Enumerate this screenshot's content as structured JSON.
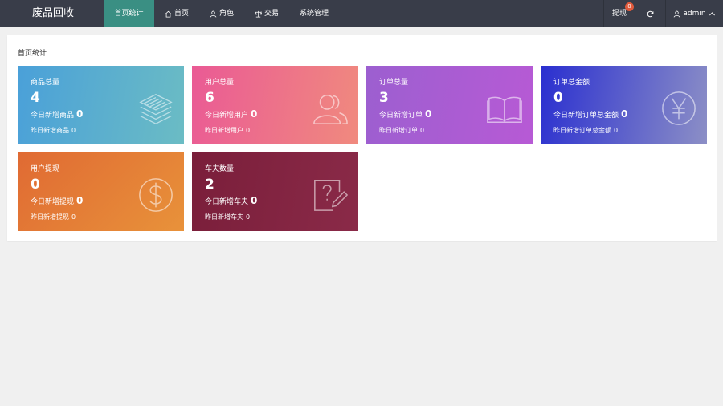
{
  "app": {
    "brand": "废品回收"
  },
  "nav": [
    {
      "label": "首页统计",
      "icon": "",
      "active": true
    },
    {
      "label": "首页",
      "icon": "home-icon"
    },
    {
      "label": "角色",
      "icon": "user-icon"
    },
    {
      "label": "交易",
      "icon": "scale-icon"
    },
    {
      "label": "系统管理",
      "icon": ""
    }
  ],
  "tools": {
    "withdraw_label": "提现",
    "withdraw_badge": "0",
    "refresh_icon": "refresh-icon",
    "user_name": "admin",
    "user_icon": "user-icon",
    "user_caret": "chevron-up-icon"
  },
  "panel": {
    "title": "首页统计",
    "cards": [
      {
        "title": "商品总量",
        "value": "4",
        "today_label": "今日新增商品",
        "today_value": "0",
        "yest_label": "昨日新增商品",
        "yest_value": "0",
        "icon": "layers-icon",
        "color_from": "#4aa0d9",
        "color_to": "#6bbcc4"
      },
      {
        "title": "用户总量",
        "value": "6",
        "today_label": "今日新增用户",
        "today_value": "0",
        "yest_label": "昨日新增用户",
        "yest_value": "0",
        "icon": "users-icon",
        "color_from": "#ea5a95",
        "color_to": "#f08a7e"
      },
      {
        "title": "订单总量",
        "value": "3",
        "today_label": "今日新增订单",
        "today_value": "0",
        "yest_label": "昨日新增订单",
        "yest_value": "0",
        "icon": "book-icon",
        "color_from": "#9c5fd0",
        "color_to": "#b75ad5"
      },
      {
        "title": "订单总金额",
        "value": "0",
        "today_label": "今日新增订单总金额",
        "today_value": "0",
        "yest_label": "昨日新增订单总金额",
        "yest_value": "0",
        "icon": "yen-icon",
        "color_from": "#2a2fd0",
        "color_to": "#8c8fc6"
      },
      {
        "title": "用户提现",
        "value": "0",
        "today_label": "今日新增提现",
        "today_value": "0",
        "yest_label": "昨日新增提现",
        "yest_value": "0",
        "icon": "dollar-icon",
        "color_from": "#e06a33",
        "color_to": "#e8923a"
      },
      {
        "title": "车夫数量",
        "value": "2",
        "today_label": "今日新增车夫",
        "today_value": "0",
        "yest_label": "昨日新增车夫",
        "yest_value": "0",
        "icon": "question-edit-icon",
        "color_from": "#7a1e3a",
        "color_to": "#8a2a48"
      }
    ]
  }
}
